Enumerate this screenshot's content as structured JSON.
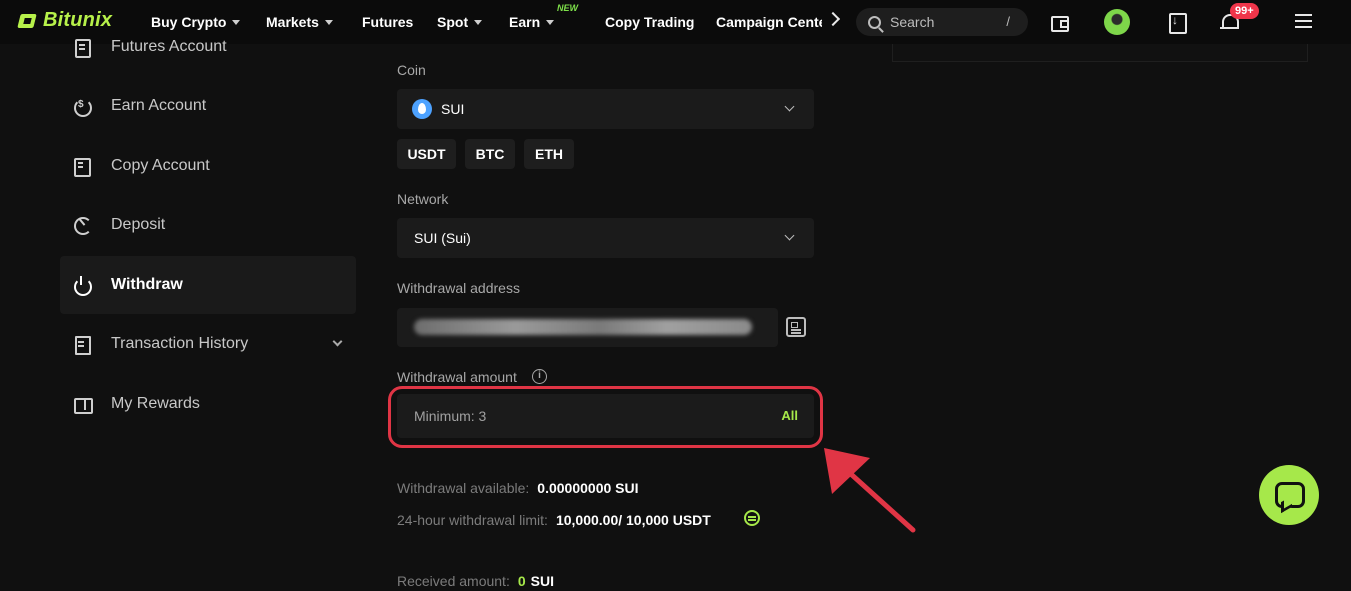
{
  "brand": {
    "name": "Bitunix"
  },
  "nav": {
    "buy_crypto": "Buy Crypto",
    "markets": "Markets",
    "futures": "Futures",
    "spot": "Spot",
    "earn": "Earn",
    "earn_badge": "NEW",
    "copy_trading": "Copy Trading",
    "campaign_center": "Campaign Center",
    "search_placeholder": "Search",
    "search_shortcut": "/",
    "notifications_count": "99+"
  },
  "sidebar": {
    "items": [
      {
        "label": "Futures Account"
      },
      {
        "label": "Earn Account"
      },
      {
        "label": "Copy Account"
      },
      {
        "label": "Deposit"
      },
      {
        "label": "Withdraw",
        "active": true
      },
      {
        "label": "Transaction History"
      },
      {
        "label": "My Rewards"
      }
    ]
  },
  "form": {
    "coin_label": "Coin",
    "coin_value": "SUI",
    "quick_coins": [
      "USDT",
      "BTC",
      "ETH"
    ],
    "network_label": "Network",
    "network_value": "SUI (Sui)",
    "address_label": "Withdrawal address",
    "amount_label": "Withdrawal amount",
    "amount_placeholder": "Minimum: 3",
    "all_label": "All",
    "available_label": "Withdrawal available:",
    "available_value": "0.00000000 SUI",
    "limit_label": "24-hour withdrawal limit:",
    "limit_value": "10,000.00/ 10,000 USDT",
    "received_label": "Received amount:",
    "received_value": "0",
    "received_unit": "SUI"
  },
  "colors": {
    "accent": "#a6e84a",
    "highlight": "#e03545",
    "background": "#101010"
  }
}
